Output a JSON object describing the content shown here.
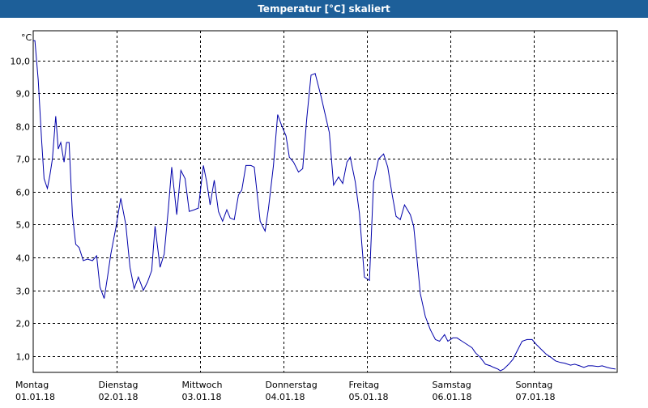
{
  "chart_data": {
    "type": "line",
    "title": "Temperatur [°C] skaliert",
    "ylabel": "°C",
    "ylim": [
      0.5,
      10.9
    ],
    "xlim": [
      0,
      7
    ],
    "y_ticks": [
      "1,0",
      "2,0",
      "3,0",
      "4,0",
      "5,0",
      "6,0",
      "7,0",
      "8,0",
      "9,0",
      "10,0"
    ],
    "x_ticks": [
      {
        "day": "Montag",
        "date": "01.01.18"
      },
      {
        "day": "Dienstag",
        "date": "02.01.18"
      },
      {
        "day": "Mittwoch",
        "date": "03.01.18"
      },
      {
        "day": "Donnerstag",
        "date": "04.01.18"
      },
      {
        "day": "Freitag",
        "date": "05.01.18"
      },
      {
        "day": "Samstag",
        "date": "06.01.18"
      },
      {
        "day": "Sonntag",
        "date": "07.01.18"
      }
    ],
    "grid": true,
    "colors": {
      "line": "#0000aa",
      "grid": "#000000",
      "title_bg": "#1d5f99"
    },
    "series": [
      {
        "x": [
          0,
          0.02,
          0.06,
          0.1,
          0.13,
          0.17,
          0.2,
          0.23,
          0.27,
          0.3,
          0.33,
          0.37,
          0.4,
          0.43,
          0.47,
          0.51,
          0.55,
          0.6,
          0.65,
          0.71,
          0.76,
          0.8,
          0.85,
          0.89,
          0.93,
          0.99,
          1.05,
          1.11,
          1.16,
          1.21,
          1.26,
          1.32,
          1.37,
          1.42,
          1.46,
          1.52,
          1.57,
          1.62,
          1.66,
          1.72,
          1.77,
          1.82,
          1.87,
          1.93,
          1.98,
          2.04,
          2.08,
          2.12,
          2.17,
          2.22,
          2.27,
          2.32,
          2.36,
          2.41,
          2.46,
          2.5,
          2.55,
          2.61,
          2.65,
          2.72,
          2.78,
          2.82,
          2.88,
          2.93,
          2.98,
          3.03,
          3.07,
          3.12,
          3.18,
          3.23,
          3.28,
          3.33,
          3.38,
          3.45,
          3.5,
          3.55,
          3.6,
          3.66,
          3.71,
          3.76,
          3.8,
          3.86,
          3.91,
          3.97,
          4.03,
          4.08,
          4.14,
          4.2,
          4.25,
          4.3,
          4.35,
          4.4,
          4.45,
          4.52,
          4.56,
          4.6,
          4.64,
          4.7,
          4.76,
          4.82,
          4.87,
          4.93,
          4.97,
          5.03,
          5.08,
          5.14,
          5.2,
          5.26,
          5.3,
          5.36,
          5.42,
          5.48,
          5.52,
          5.57,
          5.6,
          5.64,
          5.7,
          5.75,
          5.8,
          5.86,
          5.92,
          5.98,
          6.03,
          6.09,
          6.15,
          6.21,
          6.26,
          6.32,
          6.37,
          6.44,
          6.49,
          6.55,
          6.6,
          6.65,
          6.7,
          6.77,
          6.82,
          6.88,
          6.93,
          6.98
        ],
        "y": [
          10.6,
          10.6,
          9.4,
          7.6,
          6.4,
          6.1,
          6.5,
          7.0,
          8.3,
          7.3,
          7.5,
          6.9,
          7.5,
          7.5,
          5.3,
          4.4,
          4.3,
          3.9,
          3.95,
          3.9,
          4.05,
          3.1,
          2.75,
          3.4,
          4.1,
          4.9,
          5.8,
          5.0,
          3.7,
          3.05,
          3.4,
          3.0,
          3.25,
          3.6,
          4.95,
          3.7,
          4.1,
          5.5,
          6.75,
          5.3,
          6.65,
          6.4,
          5.4,
          5.45,
          5.5,
          6.8,
          6.3,
          5.6,
          6.35,
          5.4,
          5.1,
          5.45,
          5.2,
          5.15,
          5.9,
          6.05,
          6.8,
          6.8,
          6.75,
          5.1,
          4.8,
          5.5,
          6.8,
          8.35,
          8.0,
          7.7,
          7.05,
          6.9,
          6.6,
          6.7,
          8.25,
          9.55,
          9.6,
          8.9,
          8.35,
          7.8,
          6.2,
          6.45,
          6.25,
          6.9,
          7.05,
          6.3,
          5.35,
          3.4,
          3.3,
          6.3,
          7.0,
          7.15,
          6.75,
          5.95,
          5.25,
          5.15,
          5.6,
          5.3,
          4.95,
          3.95,
          2.9,
          2.2,
          1.8,
          1.5,
          1.45,
          1.65,
          1.45,
          1.55,
          1.55,
          1.45,
          1.35,
          1.25,
          1.1,
          0.95,
          0.75,
          0.7,
          0.65,
          0.6,
          0.55,
          0.6,
          0.75,
          0.9,
          1.15,
          1.45,
          1.5,
          1.5,
          1.35,
          1.2,
          1.05,
          0.95,
          0.85,
          0.8,
          0.78,
          0.72,
          0.75,
          0.7,
          0.65,
          0.7,
          0.7,
          0.68,
          0.7,
          0.65,
          0.62,
          0.6
        ]
      }
    ]
  }
}
